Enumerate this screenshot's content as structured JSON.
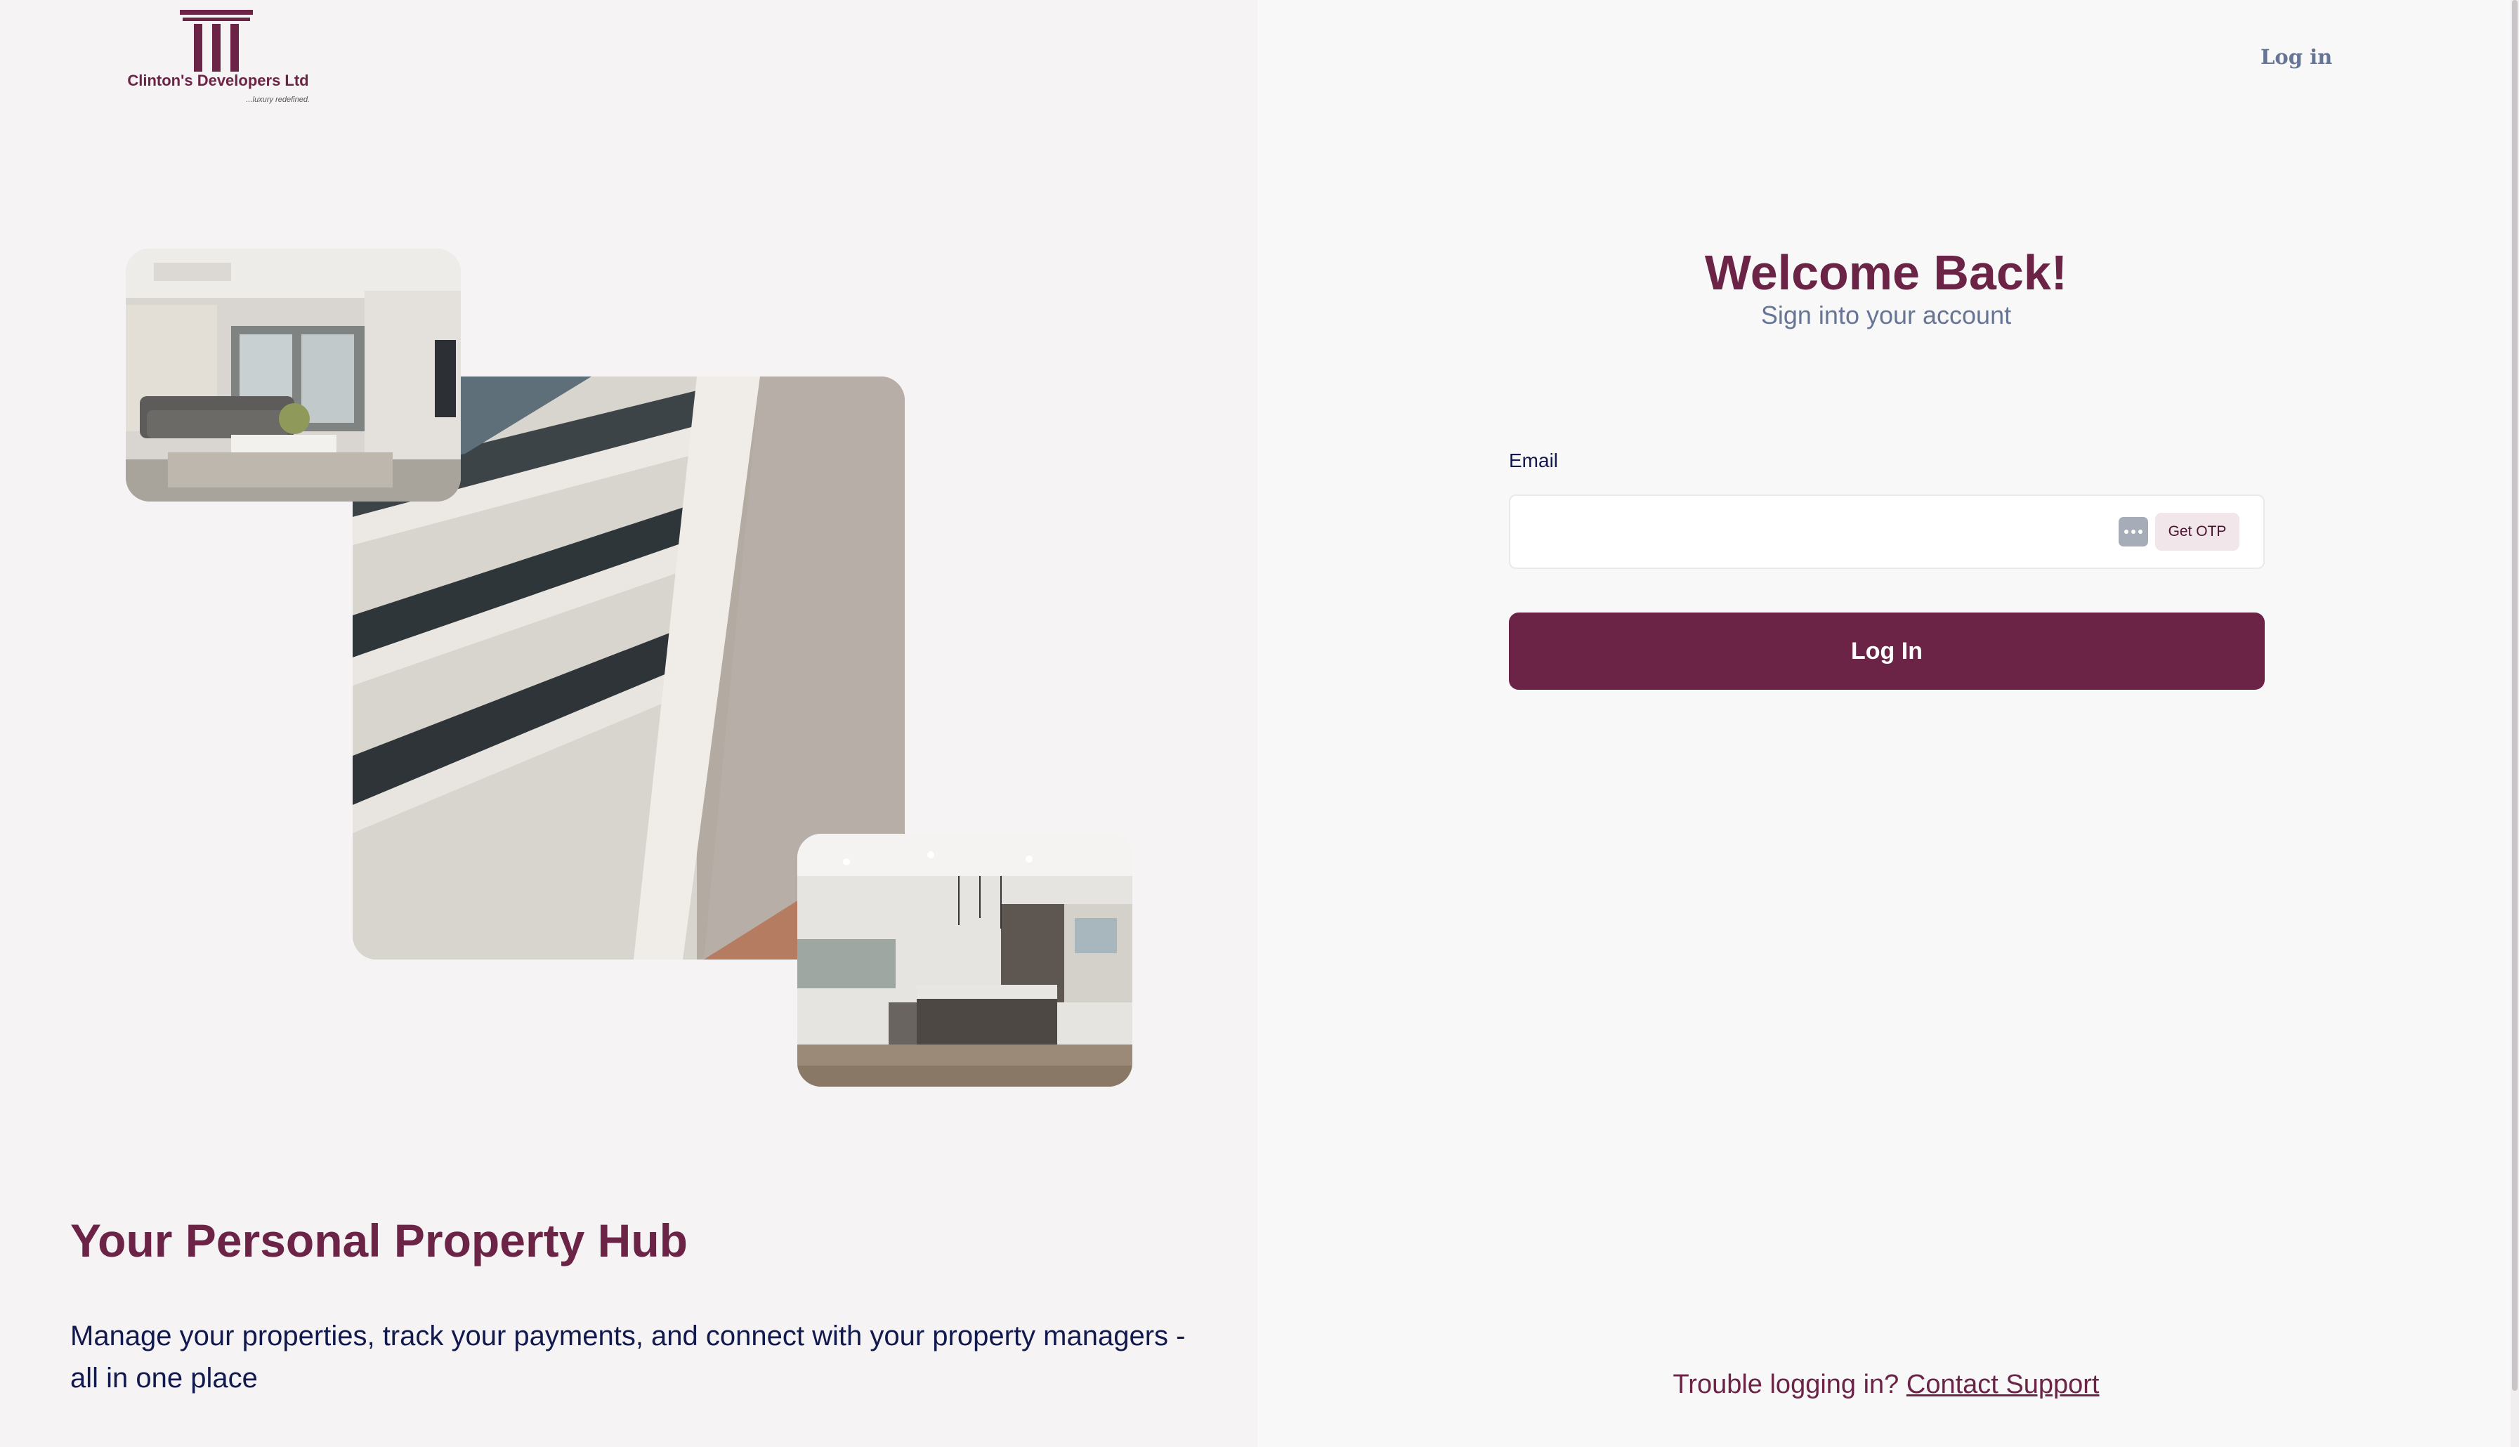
{
  "brand": {
    "name": "Clinton's Developers Ltd",
    "tagline": "...luxury redefined.",
    "color": "#6b2346"
  },
  "hero": {
    "title": "Your Personal Property Hub",
    "description": "Manage your properties, track your payments, and connect with your property managers - all in one place"
  },
  "nav": {
    "login_link": "Log in"
  },
  "auth": {
    "heading": "Welcome Back!",
    "subheading": "Sign into your account",
    "email_label": "Email",
    "email_value": "",
    "otp_button": "Get OTP",
    "submit_button": "Log In"
  },
  "support": {
    "prompt": "Trouble logging in?",
    "link": "Contact Support"
  },
  "icons": {
    "logo": "pillars-logo-icon",
    "autofill": "password-manager-icon"
  }
}
